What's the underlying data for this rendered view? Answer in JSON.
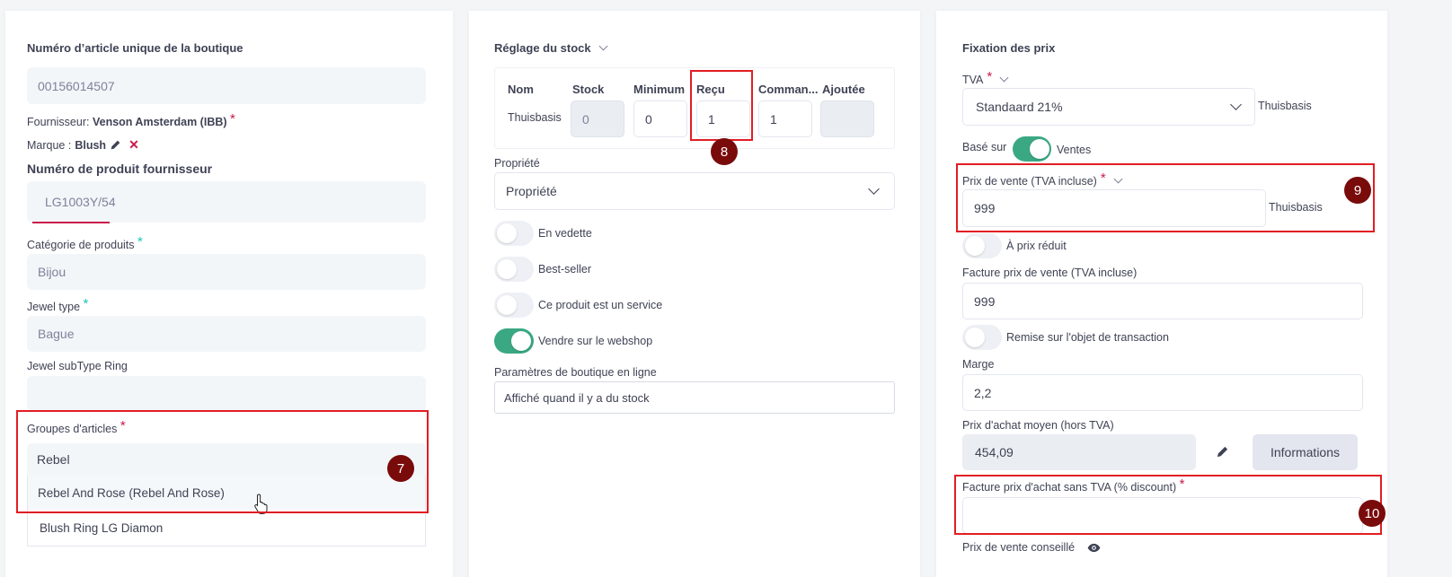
{
  "col1": {
    "shop_article_title": "Numéro d’article unique de la boutique",
    "shop_article_value": "00156014507",
    "supplier_label": "Fournisseur:",
    "supplier_value": "Venson Amsterdam (IBB)",
    "brand_label": "Marque :",
    "brand_value": "Blush",
    "supplier_product_title": "Numéro de produit fournisseur",
    "supplier_product_value": "LG1003Y/54",
    "category_label": "Catégorie de produits",
    "category_value": "Bijou",
    "jewel_type_label": "Jewel type",
    "jewel_type_value": "Bague",
    "jewel_subtype_label": "Jewel subType Ring",
    "jewel_subtype_value": "",
    "groups_label": "Groupes d'articles",
    "groups_input": "Rebel",
    "groups_options": [
      "Rebel And Rose (Rebel And Rose)",
      "Blush Ring LG Diamon"
    ],
    "badge": "7"
  },
  "col2": {
    "stock_title": "Réglage du stock",
    "table_headers": [
      "Nom",
      "Stock",
      "Minimum",
      "Reçu",
      "Comman...",
      "Ajoutée"
    ],
    "row_name": "Thuisbasis",
    "row_values": [
      "0",
      "0",
      "1",
      "1",
      ""
    ],
    "badge": "8",
    "property_label": "Propriété",
    "property_value": "Propriété",
    "toggles": [
      {
        "label": "En vedette",
        "on": false
      },
      {
        "label": "Best-seller",
        "on": false
      },
      {
        "label": "Ce produit est un service",
        "on": false
      },
      {
        "label": "Vendre sur le webshop",
        "on": true
      }
    ],
    "online_label": "Paramètres de boutique en ligne",
    "online_value": "Affiché quand il y a du stock"
  },
  "col3": {
    "pricing_title": "Fixation des prix",
    "tva_label": "TVA",
    "tva_value": "Standaard 21%",
    "tva_location": "Thuisbasis",
    "based_on_label": "Basé sur",
    "based_on_value": "Ventes",
    "sale_price_label": "Prix de vente (TVA incluse)",
    "sale_price_value": "999",
    "sale_price_location": "Thuisbasis",
    "badge9": "9",
    "reduced_label": "À prix réduit",
    "invoice_sale_label": "Facture prix de vente (TVA incluse)",
    "invoice_sale_value": "999",
    "discount_label": "Remise sur l'objet de transaction",
    "margin_label": "Marge",
    "margin_value": "2,2",
    "avg_purchase_label": "Prix d'achat moyen (hors TVA)",
    "avg_purchase_value": "454,09",
    "info_button": "Informations",
    "invoice_purchase_label": "Facture prix d'achat sans TVA (% discount)",
    "invoice_purchase_value": "",
    "badge10": "10",
    "recommended_label": "Prix de vente conseillé"
  },
  "colors": {
    "accent_green": "#3aa883",
    "highlight_red": "#e11d24",
    "badge_dark_red": "#7a0b0b",
    "required_red": "#c9184a",
    "required_green": "#1bc5bd"
  }
}
